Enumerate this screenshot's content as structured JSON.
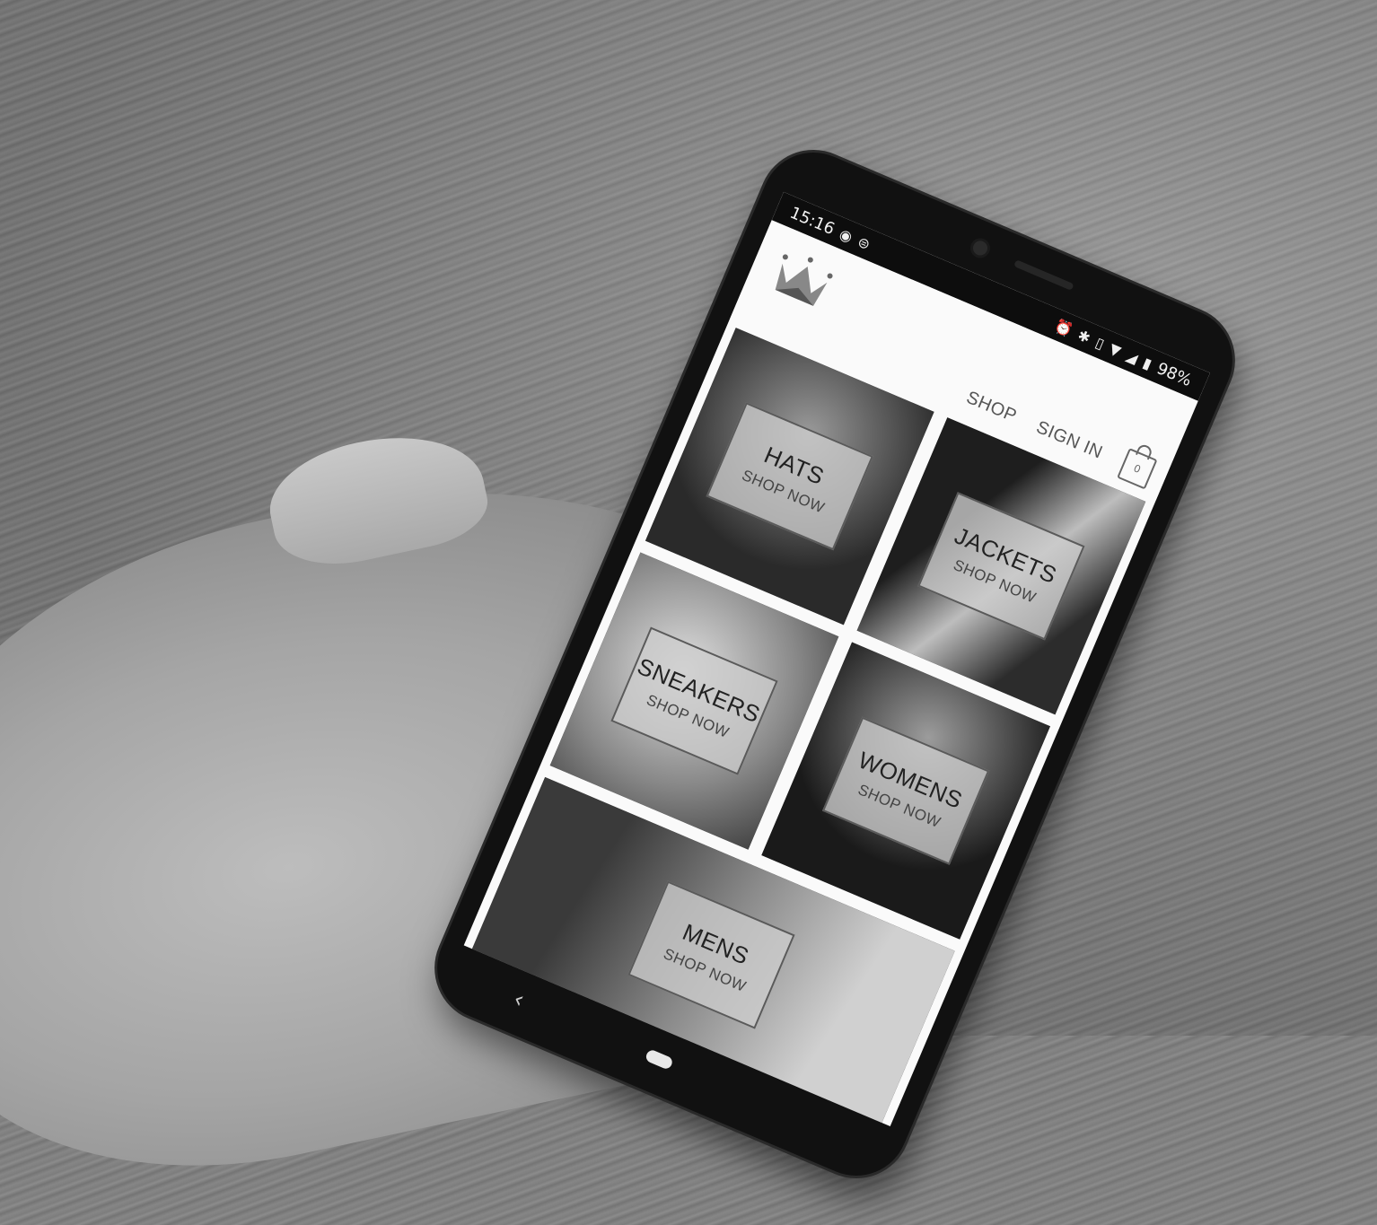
{
  "status_bar": {
    "time": "15:16",
    "battery": "98%"
  },
  "header": {
    "nav_shop": "SHOP",
    "nav_signin": "SIGN IN",
    "cart_count": "0"
  },
  "tiles": [
    {
      "title": "HATS",
      "cta": "SHOP NOW"
    },
    {
      "title": "JACKETS",
      "cta": "SHOP NOW"
    },
    {
      "title": "SNEAKERS",
      "cta": "SHOP NOW"
    },
    {
      "title": "WOMENS",
      "cta": "SHOP NOW"
    },
    {
      "title": "MENS",
      "cta": "SHOP NOW"
    }
  ],
  "icons": {
    "logo": "crown-icon",
    "cart": "shopping-bag-icon",
    "back": "back-chevron-icon",
    "home": "home-pill-icon"
  }
}
